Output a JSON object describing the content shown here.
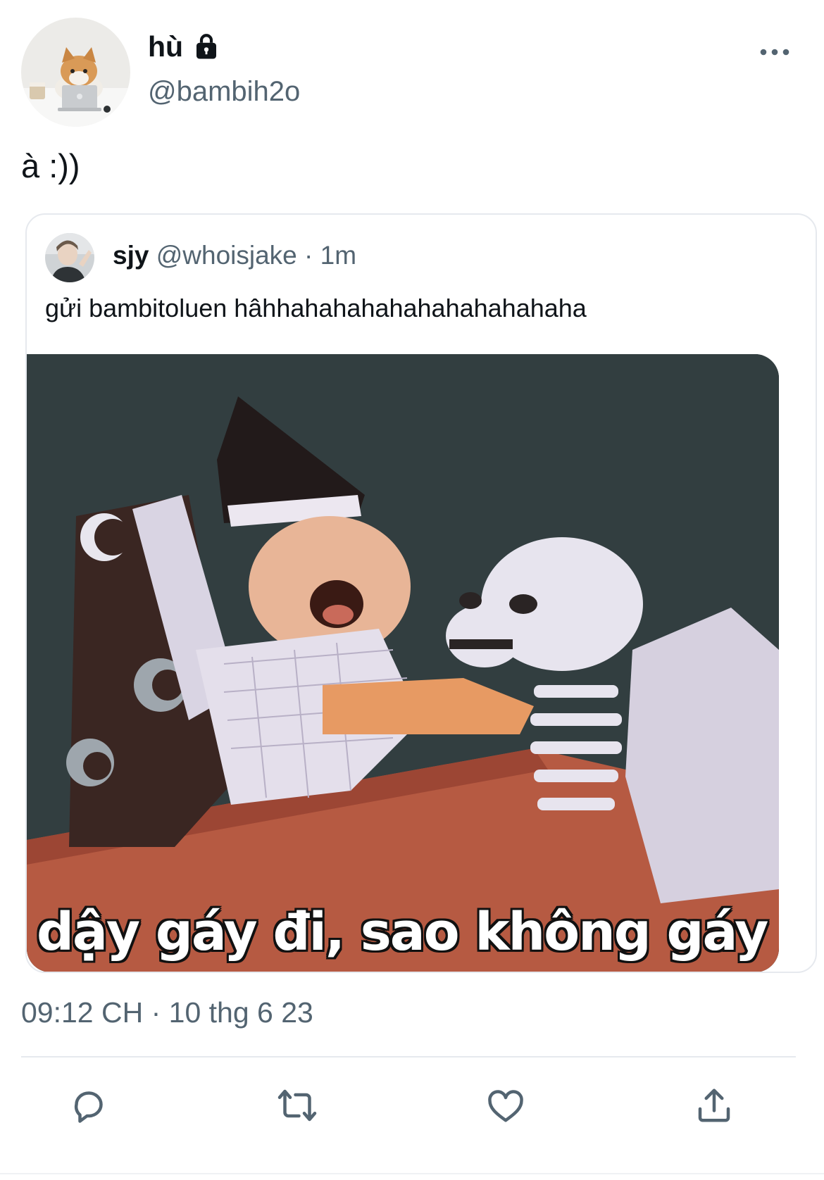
{
  "author": {
    "display_name": "hù",
    "handle": "@bambih2o",
    "protected_icon": "lock-icon",
    "avatar": "cat-with-laptop"
  },
  "tweet": {
    "text": "à :))",
    "timestamp": "09:12 CH · 10 thg 6 23"
  },
  "quoted": {
    "display_name": "sjy",
    "handle": "@whoisjake",
    "time": "· 1m",
    "text": "gửi bambitoluen hâhhahahahahahahahahahaha",
    "media_caption": "dậy gáy đi, sao không gáy nữa"
  },
  "actions": [
    {
      "name": "reply",
      "icon": "reply-icon"
    },
    {
      "name": "retweet",
      "icon": "retweet-icon"
    },
    {
      "name": "like",
      "icon": "heart-icon"
    },
    {
      "name": "share",
      "icon": "share-icon"
    }
  ],
  "colors": {
    "text_primary": "#0f1419",
    "text_secondary": "#536471",
    "border": "#e6e9ee",
    "icon": "#536471"
  }
}
